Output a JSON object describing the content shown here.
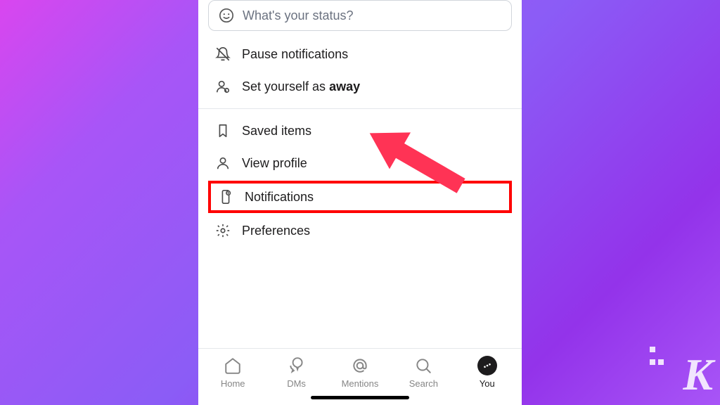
{
  "status": {
    "placeholder": "What's your status?"
  },
  "menu": {
    "pause_notifications": "Pause notifications",
    "set_away_prefix": "Set yourself as ",
    "set_away_bold": "away",
    "saved_items": "Saved items",
    "view_profile": "View profile",
    "notifications": "Notifications",
    "preferences": "Preferences"
  },
  "tabs": {
    "home": "Home",
    "dms": "DMs",
    "mentions": "Mentions",
    "search": "Search",
    "you": "You"
  },
  "watermark": "K"
}
